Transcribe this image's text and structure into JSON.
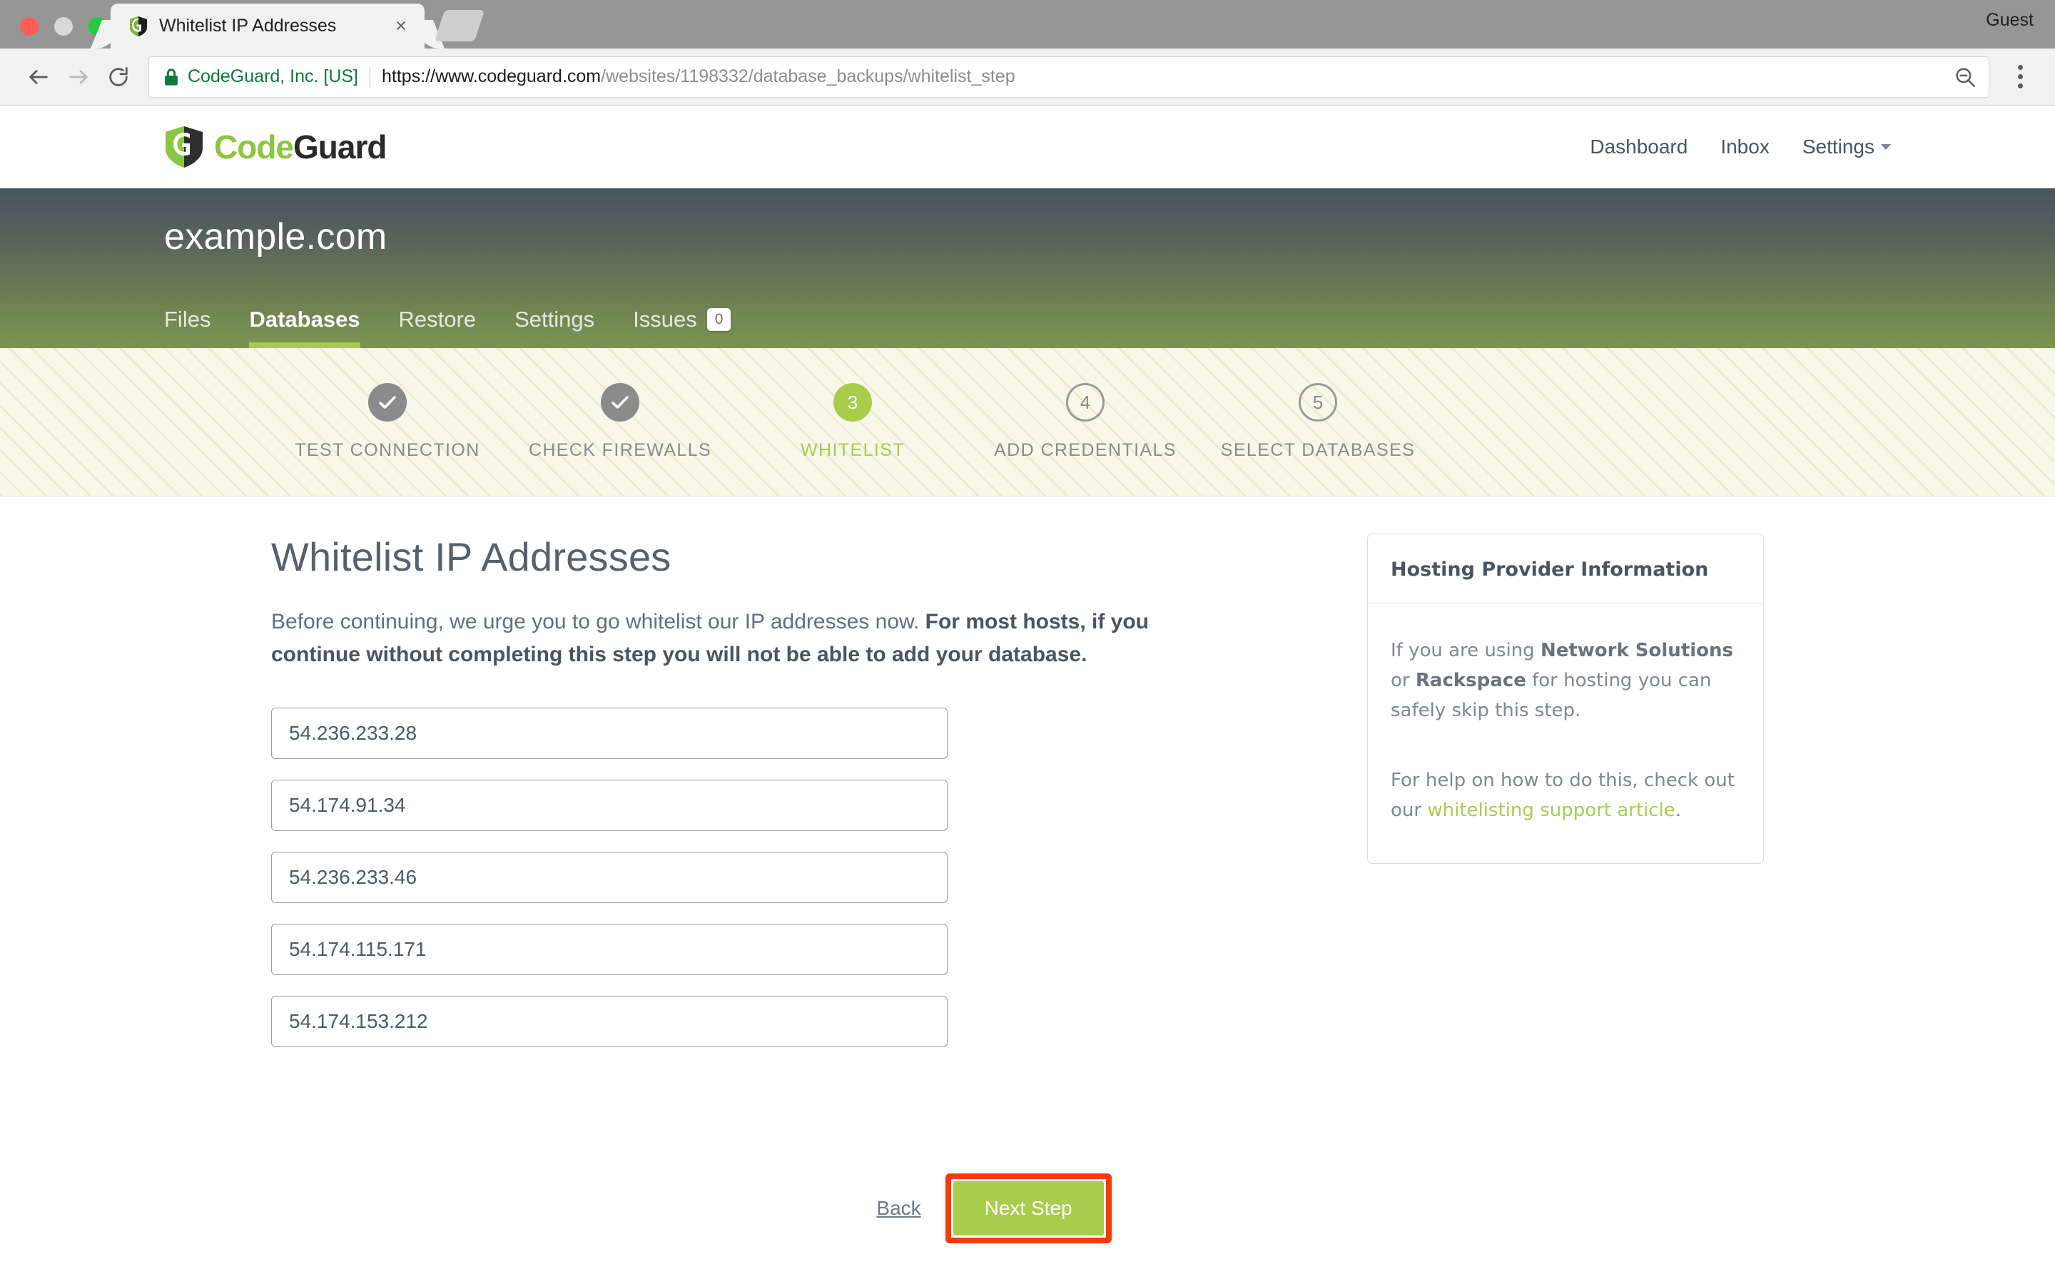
{
  "browser": {
    "tab": {
      "title": "Whitelist IP Addresses",
      "favicon": "codeguard-shield-icon",
      "close_label": "×"
    },
    "profile_label": "Guest",
    "toolbar": {
      "back_icon": "back-arrow-icon",
      "forward_icon": "forward-arrow-icon",
      "reload_icon": "reload-icon",
      "security_icon": "lock-icon",
      "security_label": "CodeGuard, Inc. [US]",
      "url_scheme": "https://",
      "url_host": "www.codeguard.com",
      "url_path": "/websites/1198332/database_backups/whitelist_step",
      "zoom_icon": "zoom-out-magnifier-icon",
      "menu_icon": "three-dot-menu-icon"
    }
  },
  "site": {
    "logo": {
      "code": "Code",
      "guard": "Guard"
    },
    "nav": [
      {
        "label": "Dashboard",
        "has_caret": false
      },
      {
        "label": "Inbox",
        "has_caret": false
      },
      {
        "label": "Settings",
        "has_caret": true
      }
    ]
  },
  "hero": {
    "title": "example.com",
    "tabs": [
      {
        "label": "Files",
        "active": false,
        "badge": null
      },
      {
        "label": "Databases",
        "active": true,
        "badge": null
      },
      {
        "label": "Restore",
        "active": false,
        "badge": null
      },
      {
        "label": "Settings",
        "active": false,
        "badge": null
      },
      {
        "label": "Issues",
        "active": false,
        "badge": "0"
      }
    ]
  },
  "wizard": {
    "steps": [
      {
        "label": "TEST CONNECTION",
        "marker": "✓",
        "state": "done"
      },
      {
        "label": "CHECK FIREWALLS",
        "marker": "✓",
        "state": "done"
      },
      {
        "label": "WHITELIST",
        "marker": "3",
        "state": "current"
      },
      {
        "label": "ADD CREDENTIALS",
        "marker": "4",
        "state": "todo"
      },
      {
        "label": "SELECT DATABASES",
        "marker": "5",
        "state": "todo"
      }
    ]
  },
  "main": {
    "title": "Whitelist IP Addresses",
    "lede_normal": "Before continuing, we urge you to go whitelist our IP addresses now. ",
    "lede_bold": "For most hosts, if you continue without completing this step you will not be able to add your database.",
    "ip_addresses": [
      "54.236.233.28",
      "54.174.91.34",
      "54.236.233.46",
      "54.174.115.171",
      "54.174.153.212"
    ],
    "back_label": "Back",
    "next_label": "Next Step"
  },
  "sidebar_card": {
    "title": "Hosting Provider Information",
    "para1_a": "If you are using ",
    "para1_b": "Network Solutions",
    "para1_c": " or ",
    "para1_d": "Rackspace",
    "para1_e": " for hosting you can safely skip this step.",
    "para2_a": "For help on how to do this, check out our ",
    "para2_link": "whitelisting support article",
    "para2_b": "."
  },
  "colors": {
    "brand_green": "#8cc63f",
    "accent_green": "#a9cc4d",
    "hero_top": "#49545f",
    "hero_bottom": "#7a9450",
    "annotation_red": "#f93a06",
    "text_slate": "#4a5560",
    "wizard_bg": "#f7f8e9"
  }
}
